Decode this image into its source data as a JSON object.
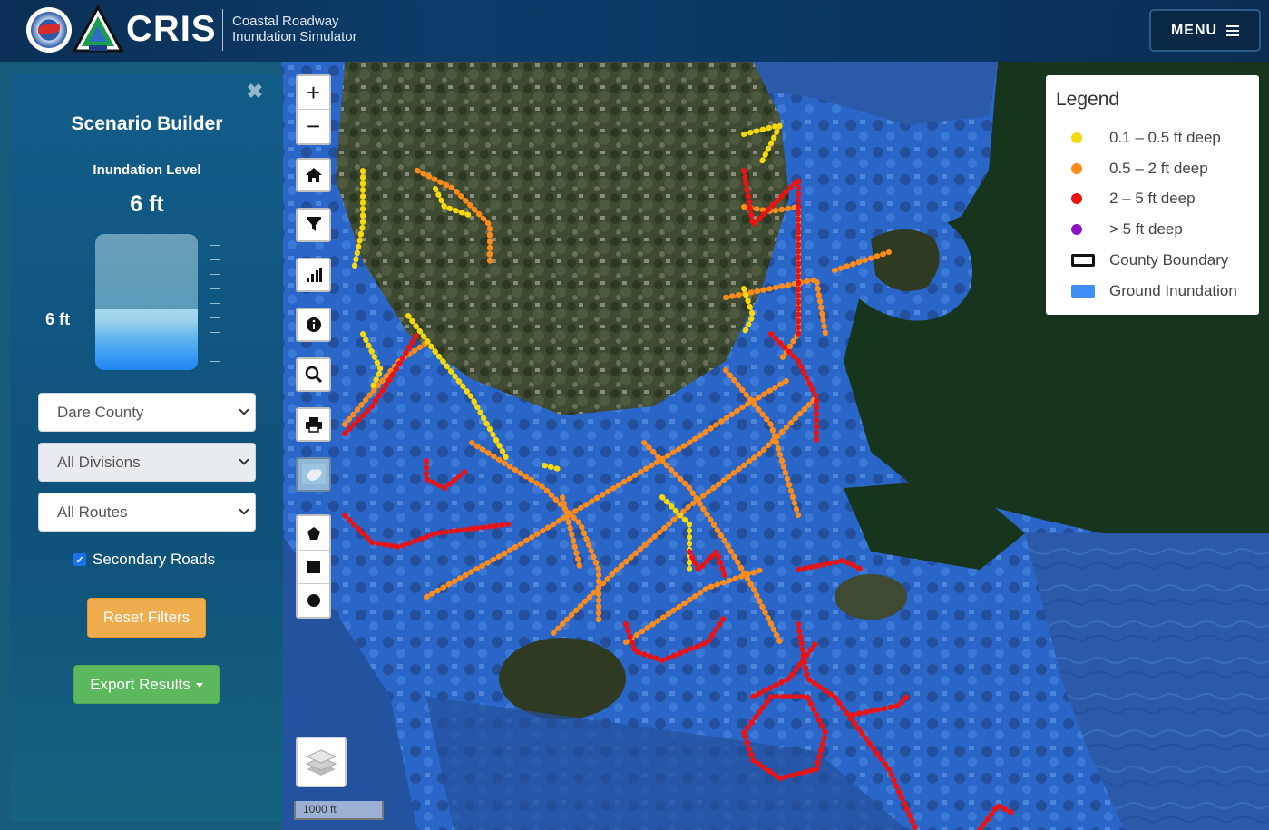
{
  "header": {
    "brand": "CRIS",
    "subtitle_line1": "Coastal Roadway",
    "subtitle_line2": "Inundation Simulator",
    "menu_label": "MENU"
  },
  "panel": {
    "close_glyph": "✖",
    "title": "Scenario Builder",
    "inundation_label": "Inundation Level",
    "inundation_value": "6 ft",
    "gauge_label": "6 ft",
    "gauge_level_fraction": 0.45,
    "county_select": "Dare County",
    "division_select": "All Divisions",
    "route_select": "All Routes",
    "secondary_roads_label": "Secondary Roads",
    "secondary_roads_checked": true,
    "reset_label": "Reset Filters",
    "export_label": "Export Results"
  },
  "map_tools": {
    "zoom_in": "+",
    "zoom_out": "−",
    "icons": [
      "home-icon",
      "filter-icon",
      "chart-icon",
      "info-icon",
      "search-icon",
      "print-icon",
      "basemap-icon",
      "polygon-icon",
      "square-icon",
      "circle-icon",
      "layers-icon"
    ],
    "scale_label": "1000 ft"
  },
  "legend": {
    "title": "Legend",
    "items": [
      {
        "label": "0.1 – 0.5 ft deep",
        "color": "#f5d90a"
      },
      {
        "label": "0.5 – 2 ft deep",
        "color": "#ff8c1a"
      },
      {
        "label": "2 – 5 ft deep",
        "color": "#ee1111"
      },
      {
        "label": "> 5 ft deep",
        "color": "#8a12c8"
      },
      {
        "label": "County Boundary",
        "color": "#000000"
      },
      {
        "label": "Ground Inundation",
        "color": "#3d8ef5"
      }
    ]
  },
  "colors": {
    "flood": "#2e6fd0",
    "land": "#2f3a22",
    "water": "#17341c",
    "yellow": "#f5d90a",
    "orange": "#ff8c1a",
    "red": "#ee1111"
  }
}
